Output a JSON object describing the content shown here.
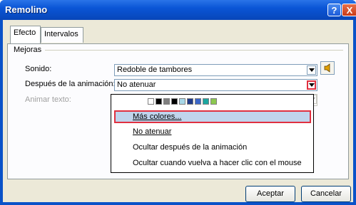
{
  "window": {
    "title": "Remolino",
    "help_label": "?",
    "close_label": "X"
  },
  "tabs": [
    {
      "label": "Efecto"
    },
    {
      "label": "Intervalos"
    }
  ],
  "group": {
    "label": "Mejoras"
  },
  "sound": {
    "label": "Sonido:",
    "value": "Redoble de tambores"
  },
  "after": {
    "label": "Después de la animación:",
    "value": "No atenuar"
  },
  "animate_text": {
    "label": "Animar texto:"
  },
  "colors": [
    "#ffffff",
    "#000000",
    "#808080",
    "#000000",
    "#a8d8e8",
    "#1f3a8a",
    "#3a66c8",
    "#1aa6a0",
    "#8cc850"
  ],
  "menu": {
    "items": [
      {
        "label": "Más colores...",
        "selected": true
      },
      {
        "label": "No atenuar"
      },
      {
        "label": "Ocultar después de la animación"
      },
      {
        "label": "Ocultar cuando vuelva a hacer clic con el mouse"
      }
    ]
  },
  "buttons": {
    "ok": "Aceptar",
    "cancel": "Cancelar"
  }
}
